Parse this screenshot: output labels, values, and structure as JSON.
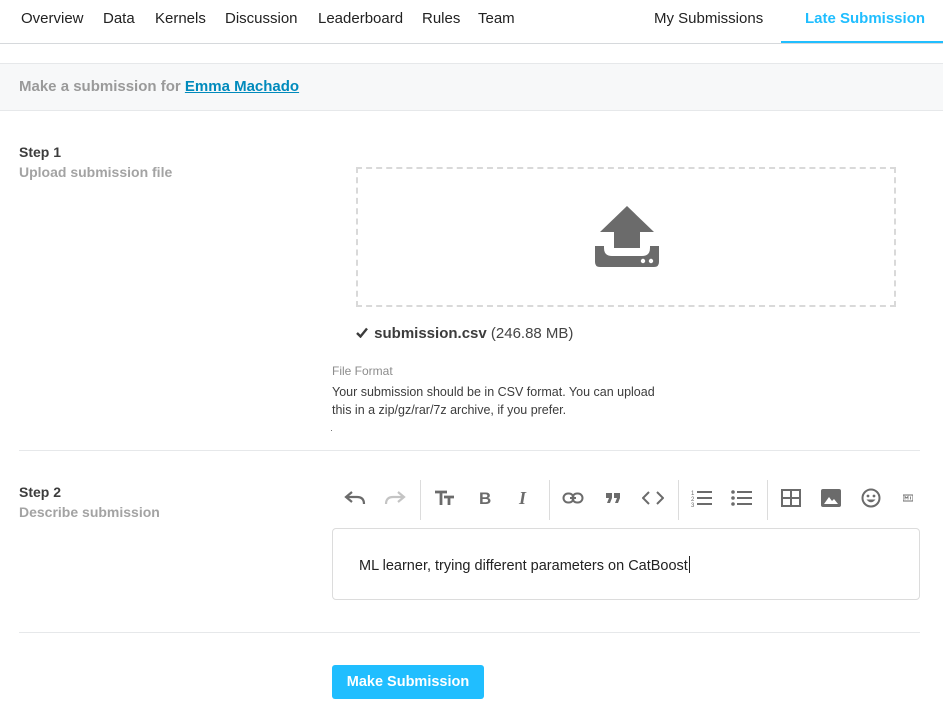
{
  "nav": {
    "tabs": [
      {
        "label": "Overview"
      },
      {
        "label": "Data"
      },
      {
        "label": "Kernels"
      },
      {
        "label": "Discussion"
      },
      {
        "label": "Leaderboard"
      },
      {
        "label": "Rules"
      },
      {
        "label": "Team"
      }
    ],
    "my_submissions": "My Submissions",
    "late_submission": "Late Submission",
    "active_tab": "Late Submission",
    "accent_color": "#20beff"
  },
  "header": {
    "prefix": "Make a submission for",
    "user_name": "Emma Machado"
  },
  "step1": {
    "title": "Step 1",
    "subtitle": "Upload submission file",
    "upload_icon": "upload-icon",
    "file_name": "submission.csv",
    "file_size": "(246.88 MB)",
    "file_format_title": "File Format",
    "file_format_desc": "Your submission should be in CSV format. You can upload this in a zip/gz/rar/7z archive, if you prefer."
  },
  "step2": {
    "title": "Step 2",
    "subtitle": "Describe submission",
    "toolbar_icons": [
      "undo-icon",
      "redo-icon",
      "text-size-icon",
      "bold-icon",
      "italic-icon",
      "link-icon",
      "quote-icon",
      "code-icon",
      "ordered-list-icon",
      "unordered-list-icon",
      "table-icon",
      "image-icon",
      "emoji-icon",
      "markdown-icon"
    ],
    "description_value": "ML learner, trying different parameters on CatBoost"
  },
  "submit": {
    "label": "Make Submission",
    "color": "#20beff"
  }
}
